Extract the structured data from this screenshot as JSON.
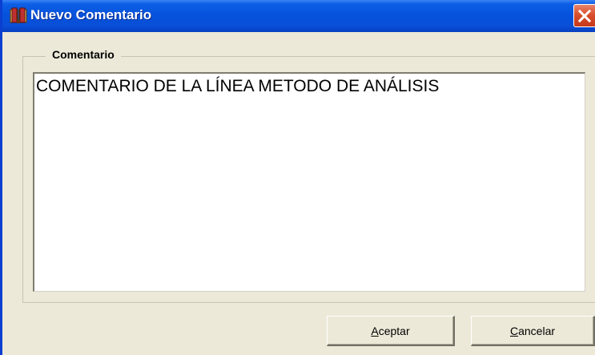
{
  "window": {
    "title": "Nuevo Comentario",
    "icon": "app-book-icon",
    "close_icon": "close-icon",
    "close_color": "#d8502e",
    "titlebar_color": "#0553dc"
  },
  "group": {
    "label": "Comentario"
  },
  "comment": {
    "value": "COMENTARIO DE LA LÍNEA METODO DE ANÁLISIS"
  },
  "buttons": {
    "accept": {
      "mnemonic": "A",
      "rest": "ceptar"
    },
    "cancel": {
      "mnemonic": "C",
      "rest": "ancelar"
    }
  }
}
